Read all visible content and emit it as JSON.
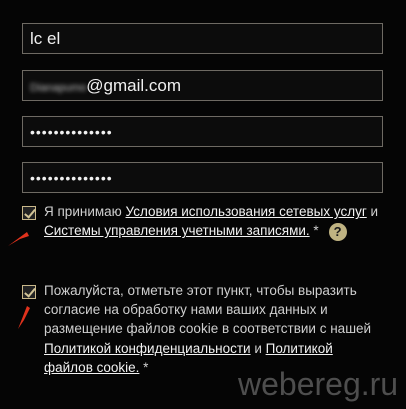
{
  "form": {
    "username": "lc      el",
    "email_local": "Dianapumo",
    "email_domain": "@gmail.com",
    "password": "••••••••••••••",
    "password_confirm": "••••••••••••••"
  },
  "agreement": {
    "prefix": "Я принимаю ",
    "terms_link": "Условия использования сетевых услуг",
    "middle": " и ",
    "systems_link": "Системы управления учетными записями.",
    "asterisk": " *",
    "help_symbol": "?"
  },
  "consent": {
    "text1": "Пожалуйста, отметьте этот пункт, чтобы выразить согласие на обработку нами ваших данных и размещение файлов cookie в соответствии с нашей ",
    "privacy_link": "Политикой конфиденциальности",
    "middle": " и ",
    "cookie_link": "Политикой файлов cookie.",
    "asterisk": " *"
  },
  "watermark": "webereg.ru",
  "colors": {
    "background": "#050505",
    "field_border": "#6e6a63",
    "checkbox_accent": "#c9b88a",
    "arrow": "#e0321c",
    "help_icon": "#bfb382"
  }
}
